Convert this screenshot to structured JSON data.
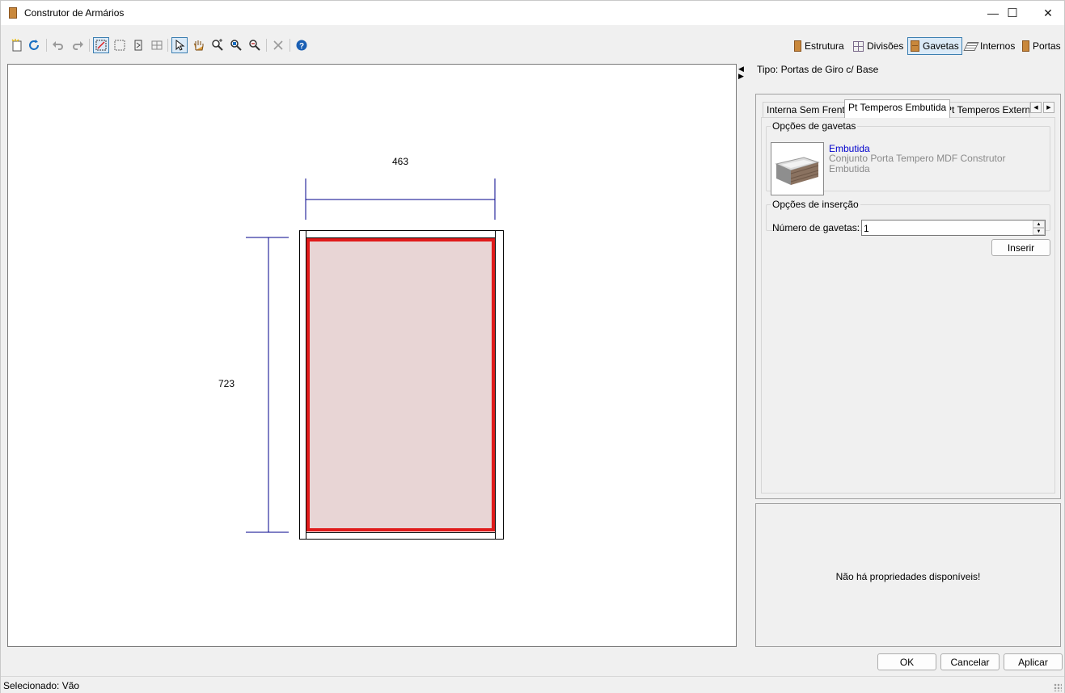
{
  "window": {
    "title": "Construtor de Armários",
    "controls": {
      "minimize": "—",
      "maximize": "☐",
      "close": "✕"
    }
  },
  "toolbar": {
    "left_icons": [
      "new-icon",
      "refresh-icon",
      "undo-icon",
      "redo-icon",
      "select-area-icon",
      "dashed-rect-icon",
      "door-outline-icon",
      "grid-icon",
      "pointer-icon",
      "pan-hand-icon",
      "zoom-in-icon",
      "zoom-fit-icon",
      "zoom-out-icon",
      "delete-icon",
      "help-icon"
    ],
    "modes": [
      {
        "label": "Estrutura",
        "icon": "door-icon"
      },
      {
        "label": "Divisões",
        "icon": "grid-icon"
      },
      {
        "label": "Gavetas",
        "icon": "drawer-icon",
        "active": true
      },
      {
        "label": "Internos",
        "icon": "internals-icon"
      },
      {
        "label": "Portas",
        "icon": "door-icon"
      }
    ]
  },
  "drawing": {
    "width_dim": "463",
    "height_dim": "723",
    "colors": {
      "dimension": "#00008b",
      "selection": "#e01b1b",
      "fill": "#e8d5d5"
    }
  },
  "panel": {
    "tipo": "Tipo: Portas de Giro c/ Base",
    "tabs": [
      "Interna Sem Frente",
      "Pt Temperos Embutida",
      "Pt Temperos Externa"
    ],
    "active_tab": "Pt Temperos Embutida",
    "drawer_options": {
      "legend": "Opções de gavetas",
      "name": "Embutida",
      "description": "Conjunto Porta Tempero MDF Construtor Embutida"
    },
    "insert_options": {
      "legend": "Opções de inserção",
      "count_label": "Número de gavetas:",
      "count_value": "1"
    },
    "insert_button": "Inserir",
    "properties_message": "Não há propriedades disponíveis!"
  },
  "footer": {
    "ok": "OK",
    "cancel": "Cancelar",
    "apply": "Aplicar"
  },
  "status": {
    "selected": "Selecionado: Vão"
  }
}
